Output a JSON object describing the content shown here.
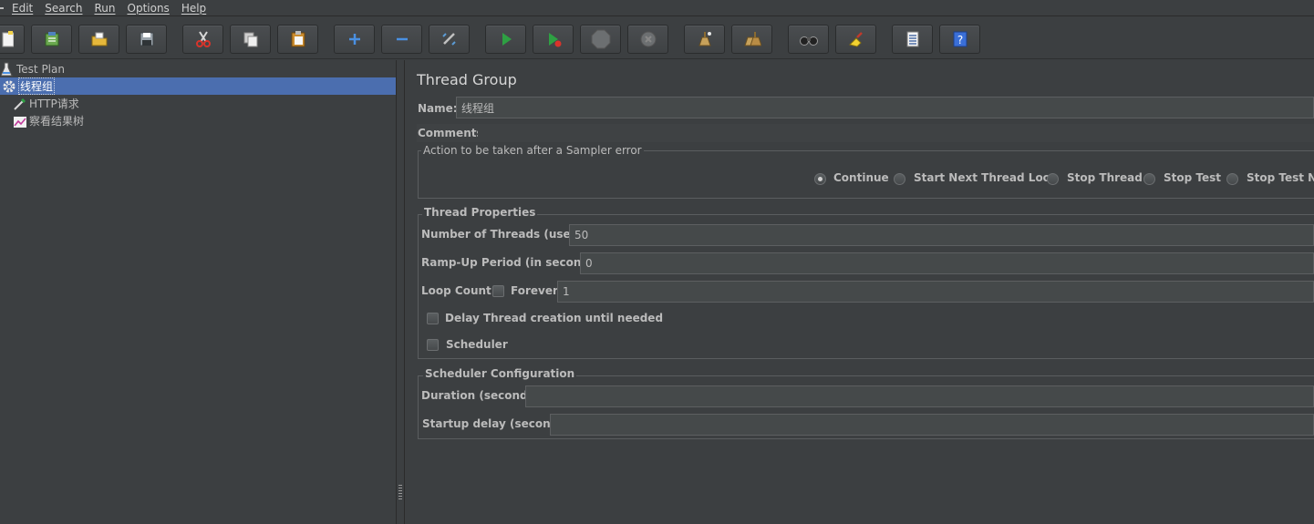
{
  "menu": {
    "items": [
      "Edit",
      "Search",
      "Run",
      "Options",
      "Help"
    ]
  },
  "toolbar": {
    "buttons": [
      "new-icon",
      "templates-icon",
      "open-icon",
      "save-icon",
      "cut-icon",
      "copy-icon",
      "paste-icon",
      "expand-icon",
      "collapse-icon",
      "toggle-icon",
      "start-icon",
      "start-no-pauses-icon",
      "stop-icon",
      "shutdown-icon",
      "clear-icon",
      "clear-all-icon",
      "search-icon",
      "reset-search-icon",
      "function-helper-icon",
      "help-icon"
    ]
  },
  "tree": {
    "items": [
      {
        "label": "Test Plan",
        "icon": "test-plan-icon"
      },
      {
        "label": "线程组",
        "icon": "gear-icon",
        "selected": true
      },
      {
        "label": "HTTP请求",
        "icon": "pipette-icon"
      },
      {
        "label": "察看结果树",
        "icon": "chart-icon"
      }
    ]
  },
  "panel": {
    "title": "Thread Group",
    "name_label": "Name:",
    "name_value": "线程组",
    "comments_label": "Comments:",
    "sampler_error": {
      "title": "Action to be taken after a Sampler error",
      "options": [
        "Continue",
        "Start Next Thread Loop",
        "Stop Thread",
        "Stop Test",
        "Stop Test Now"
      ],
      "selected": "Continue"
    },
    "thread_props": {
      "title": "Thread Properties",
      "threads_label": "Number of Threads (users):",
      "threads_value": "50",
      "rampup_label": "Ramp-Up Period (in seconds):",
      "rampup_value": "0",
      "loop_label": "Loop Count:",
      "forever_label": "Forever",
      "loop_value": "1",
      "delay_label": "Delay Thread creation until needed",
      "scheduler_label": "Scheduler"
    },
    "scheduler_config": {
      "title": "Scheduler Configuration",
      "duration_label": "Duration (seconds)",
      "duration_value": "",
      "startup_label": "Startup delay (seconds)",
      "startup_value": ""
    }
  }
}
